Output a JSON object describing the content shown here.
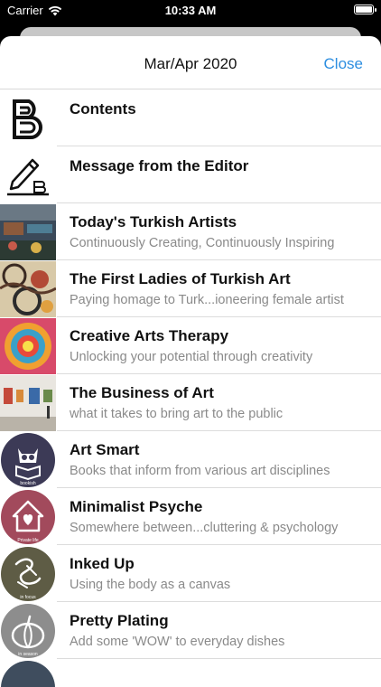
{
  "status": {
    "carrier": "Carrier",
    "time": "10:33 AM"
  },
  "header": {
    "title": "Mar/Apr 2020",
    "close_label": "Close"
  },
  "rows": [
    {
      "title": "Contents",
      "subtitle": "",
      "icon": "logo-b-icon"
    },
    {
      "title": "Message from the Editor",
      "subtitle": "",
      "icon": "pencil-icon"
    },
    {
      "title": "Today's Turkish Artists",
      "subtitle": "Continuously Creating, Continuously Inspiring",
      "icon": "gallery-photo-thumbnail"
    },
    {
      "title": "The First Ladies of Turkish Art",
      "subtitle": "Paying homage to Turk...ioneering female artist",
      "icon": "pattern-art-thumbnail"
    },
    {
      "title": "Creative Arts Therapy",
      "subtitle": "Unlocking your potential through creativity",
      "icon": "paint-swirl-thumbnail"
    },
    {
      "title": "The Business of Art",
      "subtitle": "what it takes to bring art to the public",
      "icon": "gallery-hall-thumbnail"
    },
    {
      "title": "Art Smart",
      "subtitle": "Books that inform from various art disciplines",
      "icon": "owl-book-icon",
      "badge": "bookish"
    },
    {
      "title": "Minimalist Psyche",
      "subtitle": "Somewhere between...cluttering & psychology",
      "icon": "house-heart-icon",
      "badge": "Private life"
    },
    {
      "title": "Inked Up",
      "subtitle": "Using the body as a canvas",
      "icon": "tattoo-icon",
      "badge": "in focus"
    },
    {
      "title": "Pretty Plating",
      "subtitle": "Add some 'WOW' to everyday dishes",
      "icon": "pumpkin-icon",
      "badge": "in season"
    }
  ],
  "colors": {
    "accent": "#2d8ee0",
    "art_smart": "#3c3a56",
    "minimalist": "#a24a5c",
    "inked_up": "#5e5c45",
    "pretty_plating": "#8d8d8d"
  }
}
